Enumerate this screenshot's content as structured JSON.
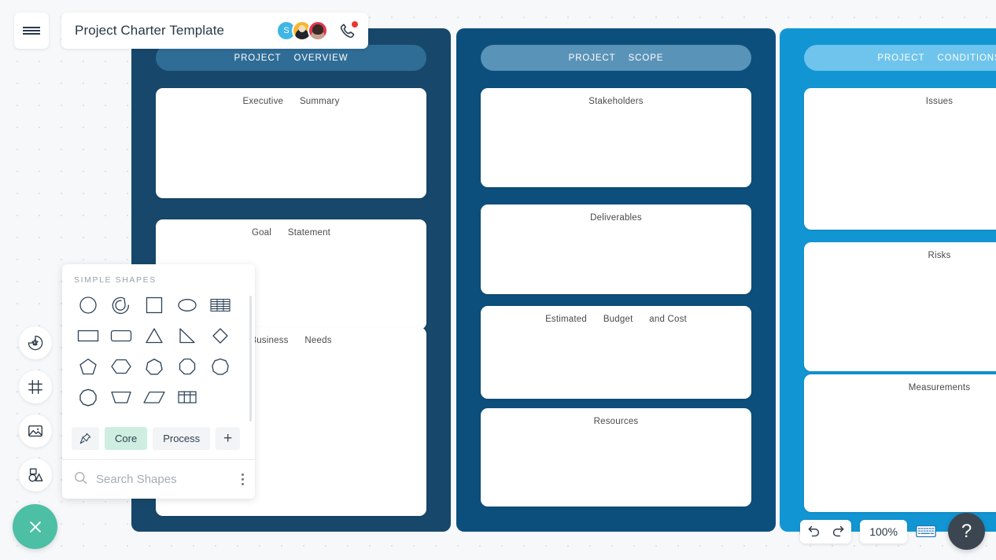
{
  "app": {
    "title": "Project Charter Template",
    "menu_icon": "hamburger-menu-icon",
    "call_icon": "phone-call-icon"
  },
  "collaborators": [
    {
      "initial": "S",
      "name": "avatar-s",
      "color": "#3fb6e3"
    },
    {
      "initial": "",
      "name": "avatar-user-2",
      "color": "#f5b731"
    },
    {
      "initial": "",
      "name": "avatar-user-3",
      "color": "#e0384f"
    }
  ],
  "rail": {
    "items": [
      {
        "icon": "sticker-badge-icon",
        "label": "Stickers"
      },
      {
        "icon": "frame-icon",
        "label": "Frames"
      },
      {
        "icon": "image-icon",
        "label": "Images"
      },
      {
        "icon": "shapes-icon",
        "label": "Shapes"
      }
    ],
    "close_label": "close-icon"
  },
  "shapes_panel": {
    "title": "SIMPLE SHAPES",
    "search_placeholder": "Search Shapes",
    "more_icon": "more-options-icon",
    "tabs": [
      {
        "label": "",
        "icon": "pin-icon",
        "active": false
      },
      {
        "label": "Core",
        "active": true
      },
      {
        "label": "Process",
        "active": false
      },
      {
        "label": "+",
        "active": false
      }
    ],
    "shapes": [
      "circle",
      "arc",
      "square",
      "ellipse",
      "table-lines",
      "rectangle",
      "rounded-rectangle",
      "triangle",
      "right-triangle",
      "diamond",
      "pentagon",
      "hexagon",
      "heptagon",
      "octagon",
      "nonagon",
      "decagon",
      "trapezoid",
      "parallelogram",
      "grid-table"
    ]
  },
  "board": {
    "columns": [
      {
        "header_word1": "PROJECT",
        "header_word2": "OVERVIEW",
        "color": "#17486b",
        "header_color": "#2f6d96",
        "cards": [
          {
            "word1": "Executive",
            "word2": "Summary"
          },
          {
            "word1": "Goal",
            "word2": "Statement"
          },
          {
            "word1": "Business",
            "word2": "Needs"
          }
        ]
      },
      {
        "header_word1": "PROJECT",
        "header_word2": "SCOPE",
        "color": "#0d4f7c",
        "header_color": "#5a93b8",
        "cards": [
          {
            "word1": "Stakeholders",
            "word2": ""
          },
          {
            "word1": "Deliverables",
            "word2": ""
          },
          {
            "word1": "Estimated",
            "word2": "Budget",
            "word3": "and Cost"
          },
          {
            "word1": "Resources",
            "word2": ""
          }
        ]
      },
      {
        "header_word1": "PROJECT",
        "header_word2": "CONDITIONS",
        "color": "#1296d3",
        "header_color": "#6ec4ec",
        "cards": [
          {
            "word1": "Issues",
            "word2": ""
          },
          {
            "word1": "Risks",
            "word2": ""
          },
          {
            "word1": "Measurements",
            "word2": ""
          }
        ]
      }
    ]
  },
  "bottom_controls": {
    "cloud_icon": "cloud-save-icon",
    "undo_icon": "undo-icon",
    "redo_icon": "redo-icon",
    "zoom_level": "100%",
    "keyboard_icon": "keyboard-shortcuts-icon",
    "help_label": "?"
  }
}
